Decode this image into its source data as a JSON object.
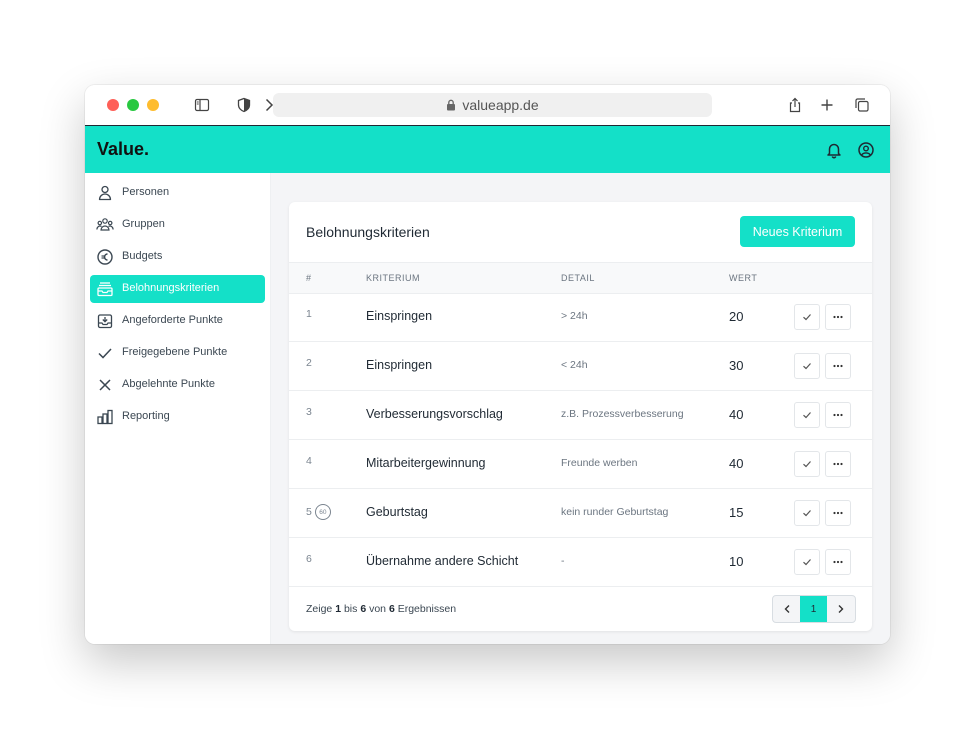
{
  "browser": {
    "url": "valueapp.de"
  },
  "app": {
    "logo": "Value."
  },
  "sidebar": {
    "items": [
      {
        "label": "Personen",
        "icon": "person-icon",
        "active": false
      },
      {
        "label": "Gruppen",
        "icon": "group-icon",
        "active": false
      },
      {
        "label": "Budgets",
        "icon": "euro-icon",
        "active": false
      },
      {
        "label": "Belohnungskriterien",
        "icon": "inbox-stack-icon",
        "active": true
      },
      {
        "label": "Angeforderte Punkte",
        "icon": "inbox-download-icon",
        "active": false
      },
      {
        "label": "Freigegebene Punkte",
        "icon": "check-icon",
        "active": false
      },
      {
        "label": "Abgelehnte Punkte",
        "icon": "x-icon",
        "active": false
      },
      {
        "label": "Reporting",
        "icon": "bar-chart-icon",
        "active": false
      }
    ]
  },
  "card": {
    "title": "Belohnungskriterien",
    "new_button": "Neues Kriterium",
    "columns": {
      "num": "#",
      "criterion": "KRITERIUM",
      "detail": "DETAIL",
      "value": "WERT"
    },
    "rows": [
      {
        "num": "1",
        "badge": "",
        "criterion": "Einspringen",
        "detail": "> 24h",
        "value": "20"
      },
      {
        "num": "2",
        "badge": "",
        "criterion": "Einspringen",
        "detail": "< 24h",
        "value": "30"
      },
      {
        "num": "3",
        "badge": "",
        "criterion": "Verbesserungsvorschlag",
        "detail": "z.B. Prozessverbesserung",
        "value": "40"
      },
      {
        "num": "4",
        "badge": "",
        "criterion": "Mitarbeitergewinnung",
        "detail": "Freunde werben",
        "value": "40"
      },
      {
        "num": "5",
        "badge": "60",
        "criterion": "Geburtstag",
        "detail": "kein runder Geburtstag",
        "value": "15"
      },
      {
        "num": "6",
        "badge": "",
        "criterion": "Übernahme andere Schicht",
        "detail": "-",
        "value": "10"
      }
    ],
    "footer": {
      "prefix": "Zeige",
      "from": "1",
      "mid1": "bis",
      "to": "6",
      "mid2": "von",
      "total": "6",
      "suffix": "Ergebnissen"
    },
    "pagination": {
      "prev": "‹",
      "current": "1",
      "next": "›"
    }
  },
  "colors": {
    "accent": "#14e0c8"
  }
}
